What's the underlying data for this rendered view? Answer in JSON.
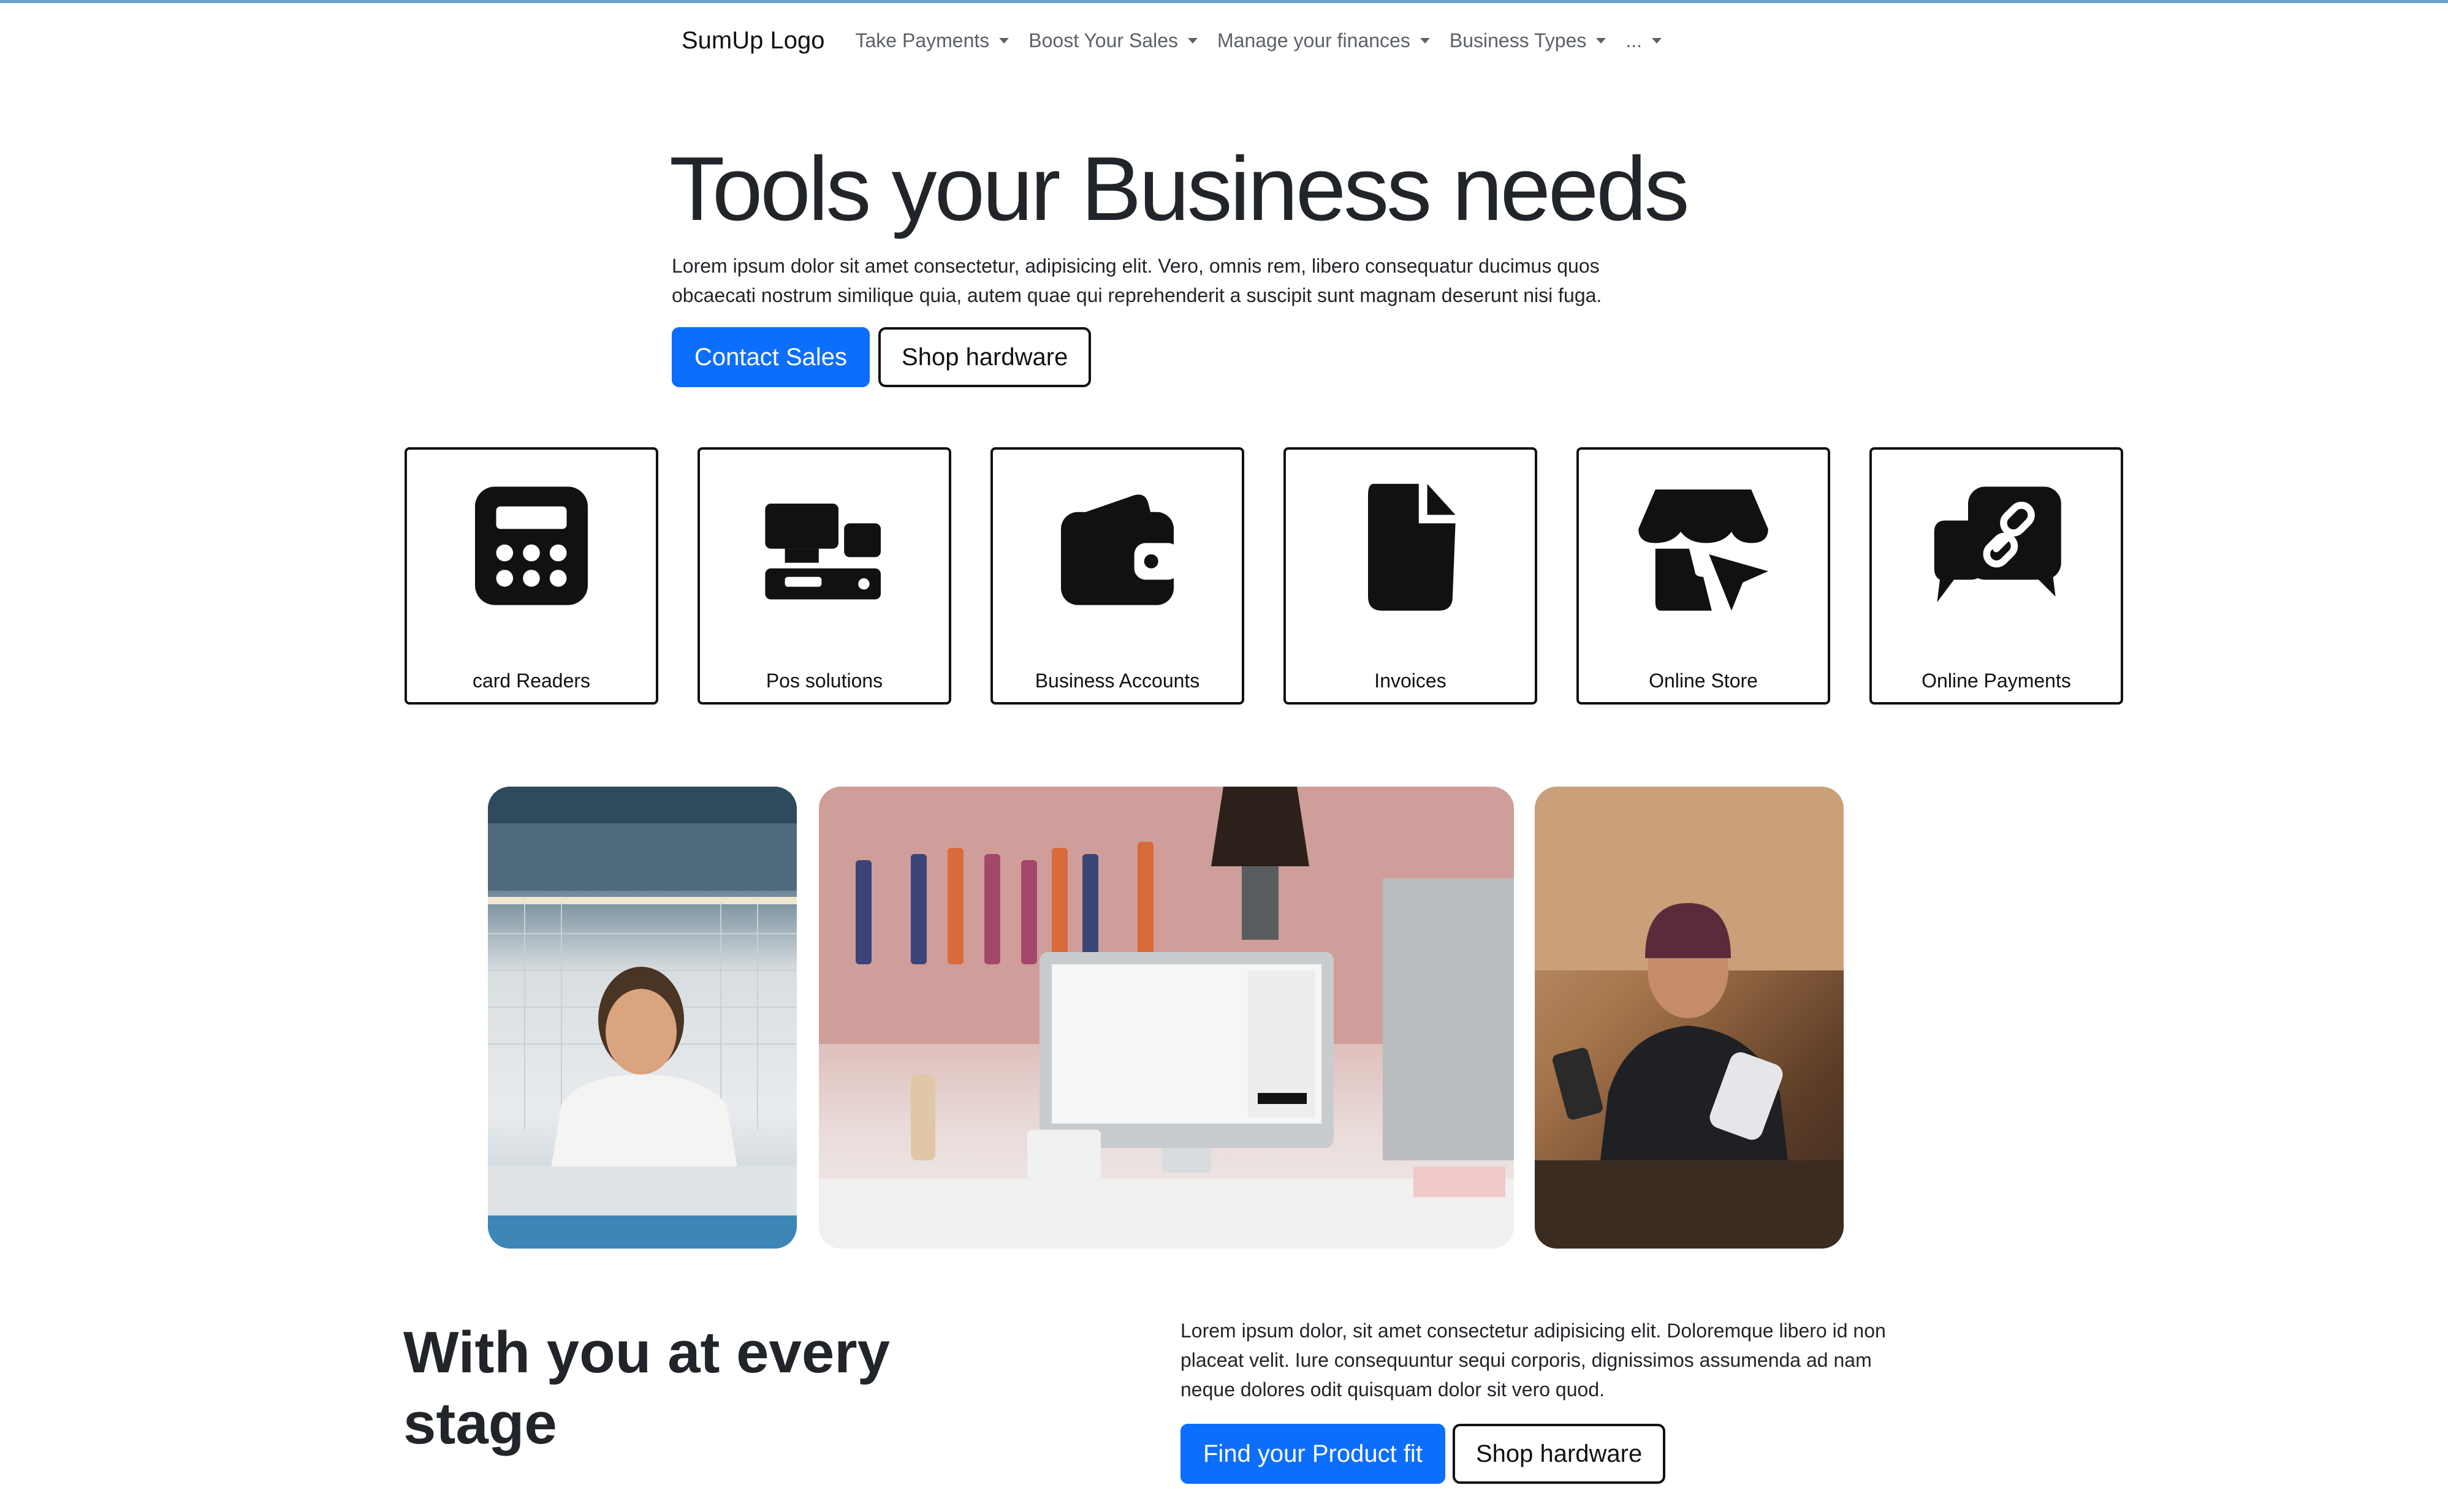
{
  "nav": {
    "brand": "SumUp Logo",
    "items": [
      {
        "label": "Take Payments"
      },
      {
        "label": "Boost Your Sales"
      },
      {
        "label": "Manage your finances"
      },
      {
        "label": "Business Types"
      },
      {
        "label": "..."
      }
    ]
  },
  "hero": {
    "title": "Tools your Business needs",
    "text": "Lorem ipsum dolor sit amet consectetur, adipisicing elit. Vero, omnis rem, libero consequatur ducimus quos obcaecati nostrum similique quia, autem quae qui reprehenderit a suscipit sunt magnam deserunt nisi fuga.",
    "primary_button": "Contact Sales",
    "secondary_button": "Shop hardware"
  },
  "categories": [
    {
      "label": "card Readers",
      "icon": "calculator-icon"
    },
    {
      "label": "Pos solutions",
      "icon": "pos-terminal-icon"
    },
    {
      "label": "Business Accounts",
      "icon": "wallet-icon"
    },
    {
      "label": "Invoices",
      "icon": "file-icon"
    },
    {
      "label": "Online Store",
      "icon": "storefront-cursor-icon"
    },
    {
      "label": "Online Payments",
      "icon": "link-chat-icon"
    }
  ],
  "stage": {
    "title": "With you at every stage",
    "text": "Lorem ipsum dolor, sit amet consectetur adipisicing elit. Doloremque libero id non placeat velit. Iure consequuntur sequi corporis, dignissimos assumenda ad nam neque dolores odit quisquam dolor sit vero quod.",
    "primary_button": "Find your Product fit",
    "secondary_button": "Shop hardware"
  },
  "colors": {
    "primary": "#0d6efd",
    "text": "#212529",
    "nav_text": "#5c6168",
    "border": "#111111"
  }
}
